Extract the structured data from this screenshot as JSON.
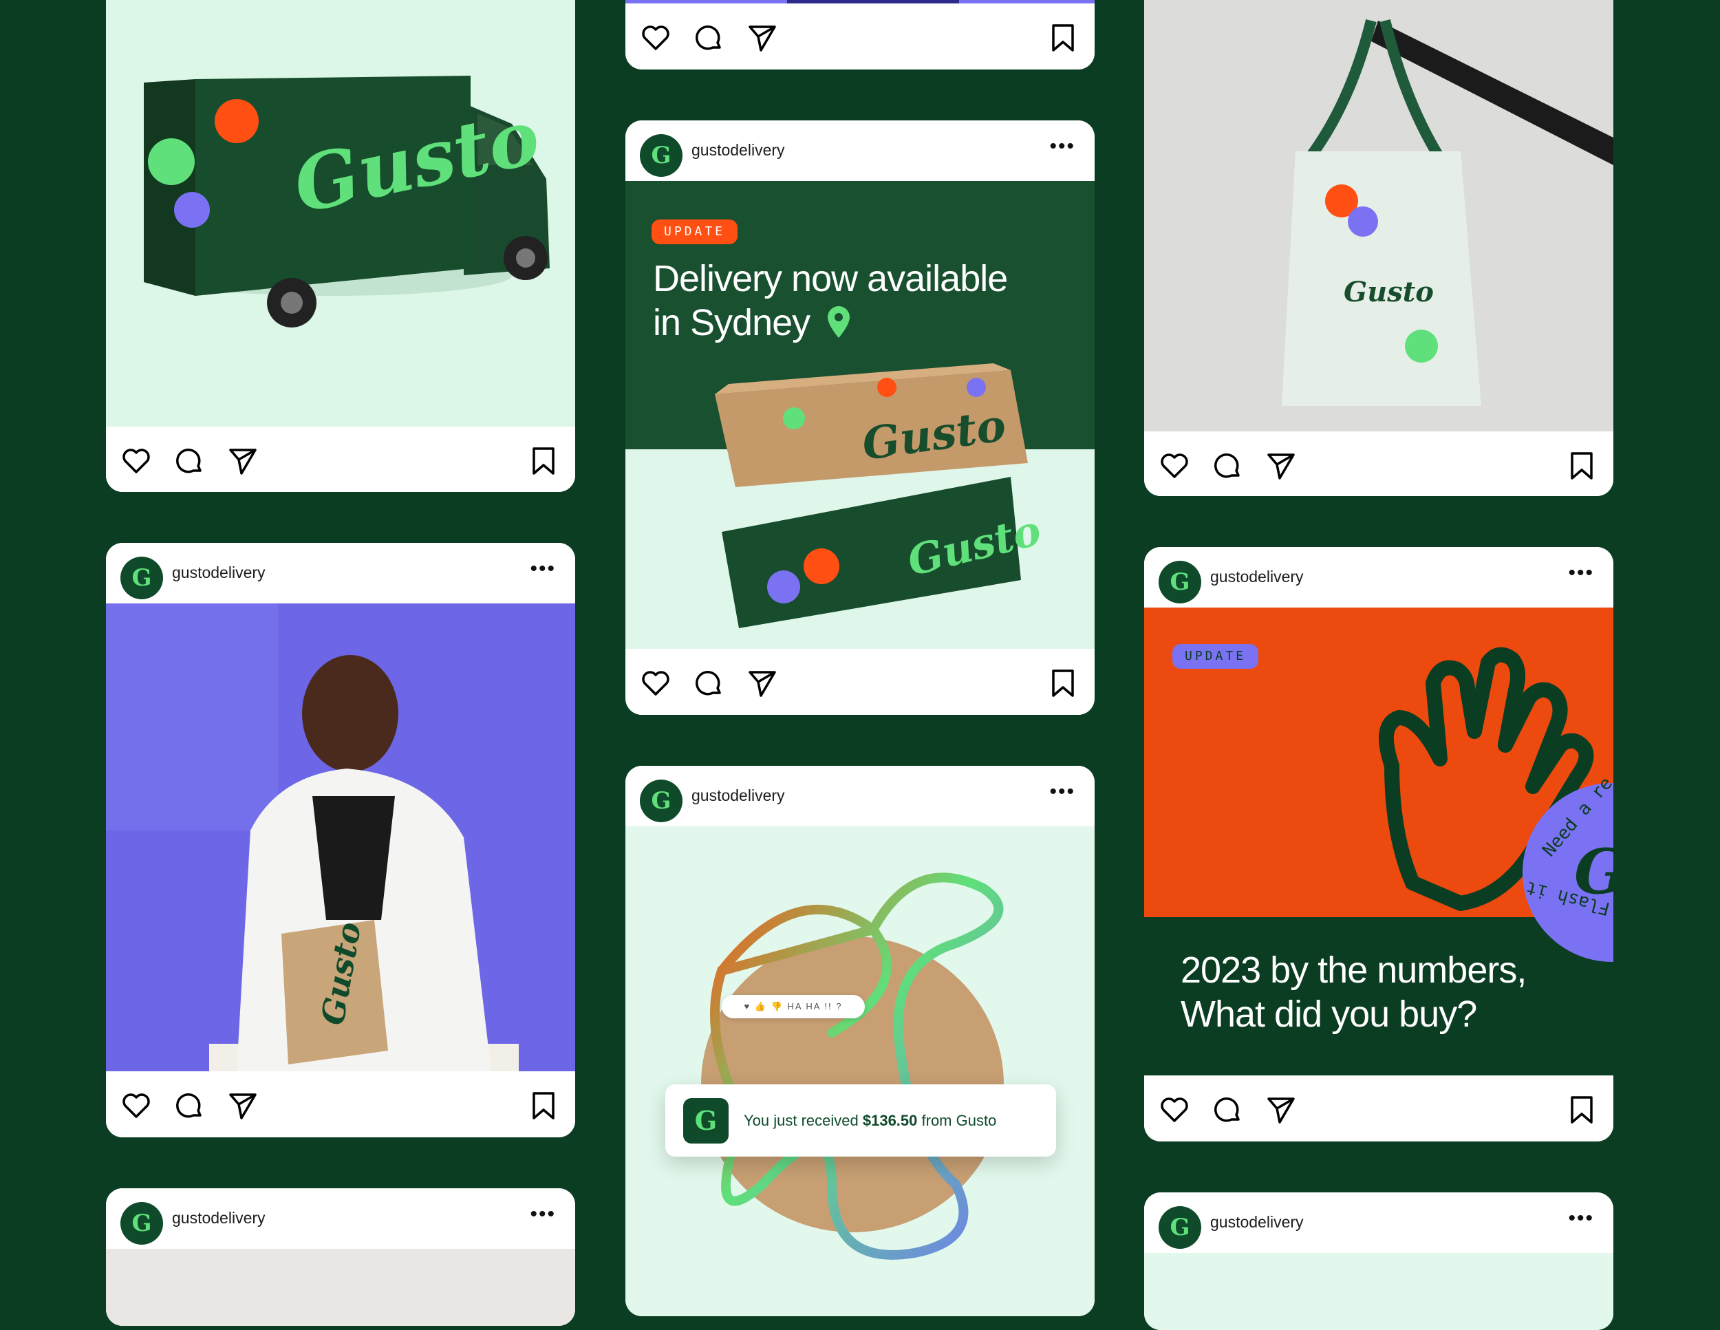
{
  "account": {
    "username": "gustodelivery",
    "avatar_letter": "G",
    "more_label": "•••"
  },
  "brand": {
    "wordmark": "Gusto",
    "green": "#5fe07a",
    "dark_green": "#0b3d22",
    "orange": "#ff4f12",
    "purple": "#7b72f3",
    "mint": "#e2fbee"
  },
  "icons": {
    "like": "heart-icon",
    "comment": "comment-icon",
    "share": "send-icon",
    "save": "bookmark-icon",
    "location": "location-pin-icon"
  },
  "posts": {
    "sydney": {
      "badge": "UPDATE",
      "headline_line1": "Delivery now available",
      "headline_line2": "in Sydney"
    },
    "numbers": {
      "badge": "UPDATE",
      "headline_line1": "2023 by the numbers,",
      "headline_line2": "What did you buy?",
      "seal_text": "Need a re",
      "seal_text2": "Flash it"
    },
    "payment": {
      "reactions": [
        "♥",
        "👍",
        "👎",
        "HA HA",
        "!!",
        "?"
      ],
      "toast_prefix": "You just received ",
      "toast_amount": "$136.50",
      "toast_suffix": " from Gusto"
    }
  }
}
